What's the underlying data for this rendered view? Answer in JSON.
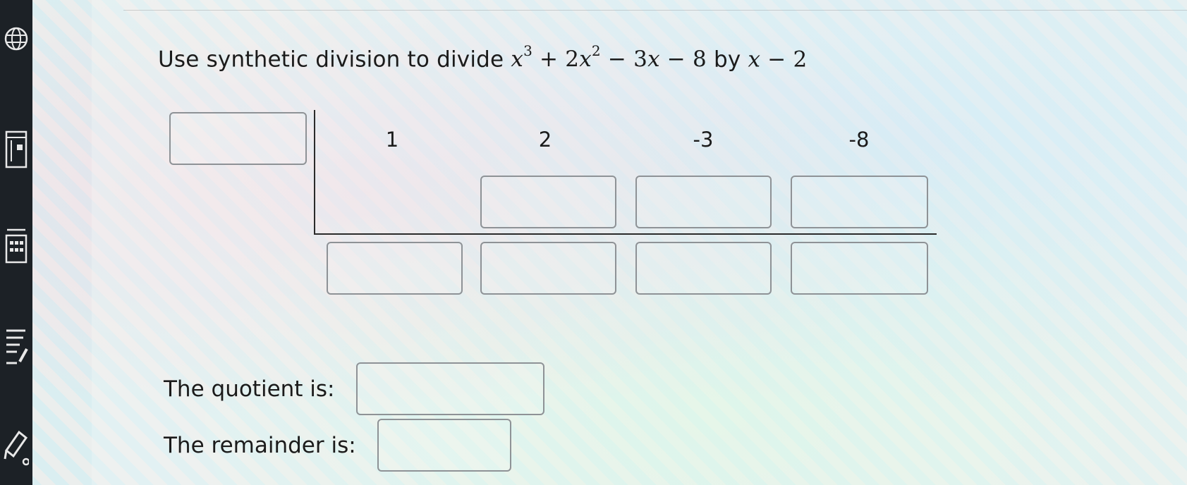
{
  "sidebar": {
    "icons": [
      "globe-icon",
      "book-icon",
      "calculator-icon",
      "notes-icon",
      "pencil-icon"
    ]
  },
  "problem": {
    "prefix": "Use synthetic division to divide",
    "dividend": {
      "t1": "x",
      "e1": "3",
      "t2": " + 2",
      "t3": "x",
      "e2": "2",
      "t4": " − 3",
      "t5": "x",
      "t6": " − 8"
    },
    "by": " by ",
    "divisor": {
      "v": "x",
      "rest": " − 2"
    }
  },
  "coefficients": [
    "1",
    "2",
    "-3",
    "-8"
  ],
  "inputs": {
    "divisor_value": "",
    "multiply_row": [
      "",
      "",
      ""
    ],
    "result_row": [
      "",
      "",
      "",
      ""
    ],
    "quotient": "",
    "remainder": ""
  },
  "labels": {
    "quotient": "The quotient is:",
    "remainder": "The remainder is:"
  }
}
